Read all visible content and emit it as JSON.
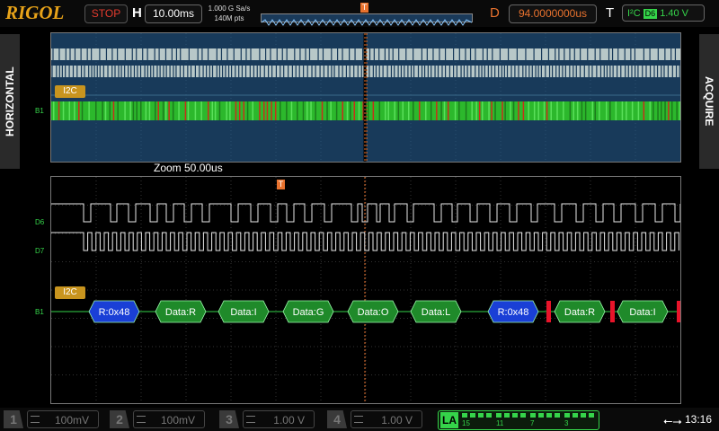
{
  "header": {
    "brand": "RIGOL",
    "run_state": "STOP",
    "horizontal_label": "H",
    "timebase": "10.00ms",
    "sample_rate": "1.000 G Sa/s",
    "memory_depth": "140M pts",
    "delay_label": "D",
    "delay": "94.0000000us",
    "trigger_label": "T",
    "trigger_type": "I²C",
    "trigger_source": "D6",
    "trigger_level": "1.40 V",
    "trigger_marker": "T"
  },
  "side_tabs": {
    "left": "HORIZONTAL",
    "right": "ACQUIRE"
  },
  "overview": {
    "bus_label": "I2C",
    "bus_channel": "B1"
  },
  "zoom": {
    "label": "Zoom  50.00us",
    "trigger_marker": "T",
    "channels": [
      "D6",
      "D7"
    ],
    "bus_label": "I2C",
    "bus_channel": "B1",
    "packets": [
      {
        "text": "R:0x48",
        "kind": "addr"
      },
      {
        "text": "Data:R",
        "kind": "data"
      },
      {
        "text": "Data:I",
        "kind": "data"
      },
      {
        "text": "Data:G",
        "kind": "data"
      },
      {
        "text": "Data:O",
        "kind": "data"
      },
      {
        "text": "Data:L",
        "kind": "data"
      },
      {
        "text": "R:0x48",
        "kind": "addr"
      },
      {
        "text": "Data:R",
        "kind": "data"
      },
      {
        "text": "Data:I",
        "kind": "data"
      }
    ]
  },
  "footer": {
    "channels": [
      {
        "num": "1",
        "scale": "100mV"
      },
      {
        "num": "2",
        "scale": "100mV"
      },
      {
        "num": "3",
        "scale": "1.00 V"
      },
      {
        "num": "4",
        "scale": "1.00 V"
      }
    ],
    "la_label": "LA",
    "la_numbers": [
      "15",
      "11",
      "7",
      "3"
    ],
    "usb_icon": "usb-icon",
    "time": "13:16"
  },
  "colors": {
    "brand": "#e8a319",
    "stop": "#e23b2e",
    "delay": "#e8722e",
    "digital": "#35d44a",
    "addr_packet": "#1a3fd6",
    "data_packet": "#1f8a2a",
    "error": "#e8142a"
  }
}
